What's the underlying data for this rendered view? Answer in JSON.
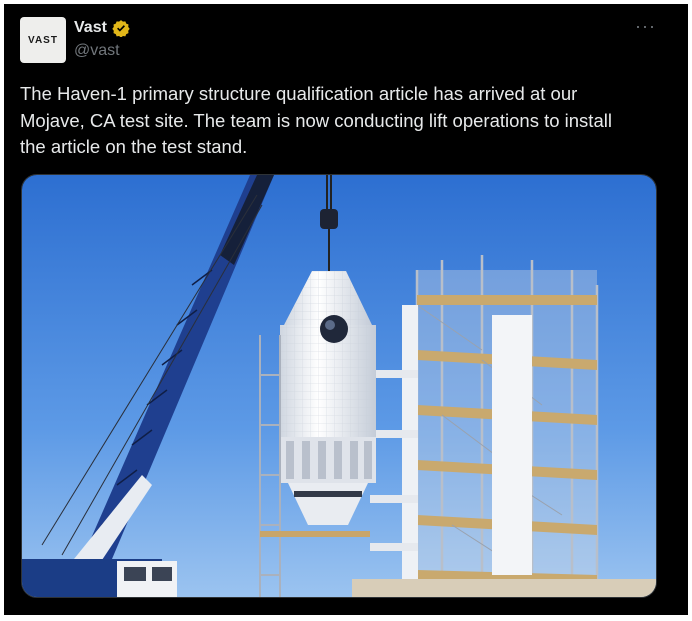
{
  "author": {
    "display_name": "Vast",
    "handle": "@vast",
    "avatar_logo_text": "VAST",
    "verified_icon": "verified-badge-icon",
    "verified_color": "#e2b719"
  },
  "menu": {
    "more_label": "···",
    "more_icon": "more-horizontal-icon"
  },
  "tweet": {
    "text": "The Haven-1 primary structure qualification article has arrived at our\nMojave, CA test site. The team is now conducting lift operations to install\nthe article on the test stand."
  },
  "media": {
    "type": "photo",
    "subject": "crane lifting spacecraft structure next to test scaffolding tower"
  },
  "colors": {
    "background": "#000000",
    "text_primary": "#e7e9ea",
    "text_secondary": "#71767b"
  }
}
